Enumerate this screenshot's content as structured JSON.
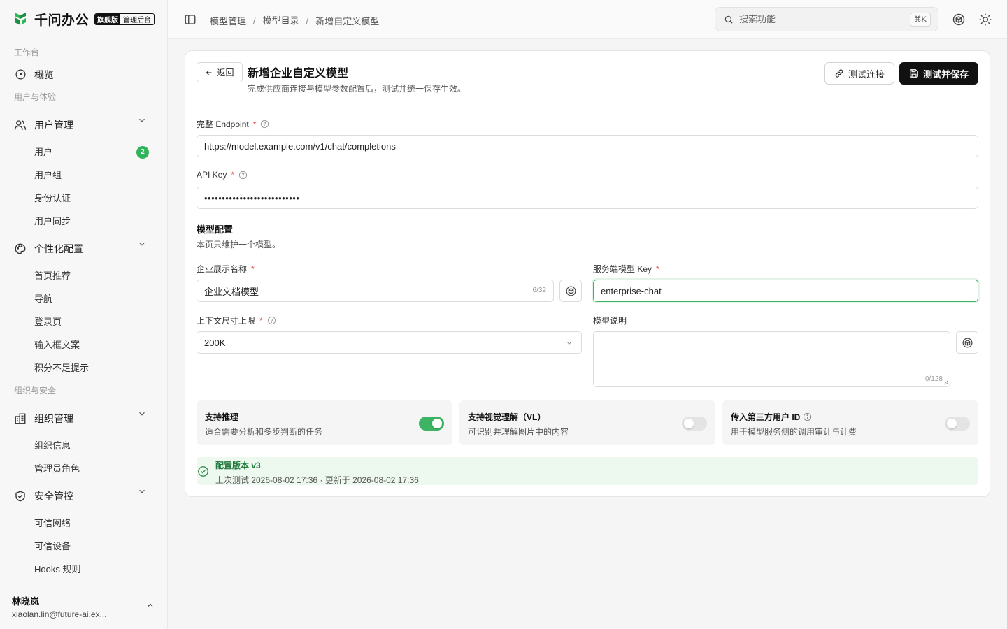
{
  "brand": {
    "name": "千问办公",
    "edition": "旗舰版",
    "admin": "管理后台"
  },
  "nav": {
    "workbench": "工作台",
    "overview": "概览",
    "users_section": "用户与体验",
    "user_mgmt": "用户管理",
    "user_items": [
      {
        "label": "用户",
        "count": "2"
      },
      {
        "label": "用户组"
      },
      {
        "label": "身份认证"
      },
      {
        "label": "用户同步"
      }
    ],
    "personalize": "个性化配置",
    "personalize_items": [
      "首页推荐",
      "导航",
      "登录页",
      "输入框文案",
      "积分不足提示"
    ],
    "org_section": "组织与安全",
    "org_mgmt": "组织管理",
    "org_items": [
      "组织信息",
      "管理员角色"
    ],
    "security": "安全管控",
    "security_items": [
      "可信网络",
      "可信设备",
      "Hooks 规则"
    ]
  },
  "user": {
    "name": "林晓岚",
    "email": "xiaolan.lin@future-ai.ex..."
  },
  "breadcrumb": [
    "模型管理",
    "模型目录",
    "新增自定义模型"
  ],
  "search": {
    "placeholder": "搜索功能",
    "shortcut": "⌘K"
  },
  "page": {
    "back": "返回",
    "title": "新增企业自定义模型",
    "subtitle": "完成供应商连接与模型参数配置后，测试并统一保存生效。",
    "test_button": "测试连接",
    "save_button": "测试并保存"
  },
  "form": {
    "endpoint_label": "完整 Endpoint",
    "endpoint_value": "https://model.example.com/v1/chat/completions",
    "apikey_label": "API Key",
    "apikey_value": "•••••••••••••••••••••••••••",
    "model_config_title": "模型配置",
    "model_config_sub": "本页只维护一个模型。",
    "display_name_label": "企业展示名称",
    "display_name_value": "企业文档模型",
    "display_name_count": "6/32",
    "server_key_label": "服务端模型 Key",
    "server_key_value": "enterprise-chat",
    "context_label": "上下文尺寸上限",
    "context_value": "200K",
    "desc_label": "模型说明",
    "desc_value": "",
    "desc_count": "0/128"
  },
  "features": [
    {
      "title": "支持推理",
      "desc": "适合需要分析和多步判断的任务",
      "on": true
    },
    {
      "title": "支持视觉理解（VL）",
      "desc": "可识别并理解图片中的内容",
      "on": false
    },
    {
      "title": "传入第三方用户 ID",
      "desc": "用于模型服务侧的调用审计与计费",
      "on": false
    }
  ],
  "status": {
    "title": "配置版本 v3",
    "detail": "上次测试 2026-08-02 17:36 · 更新于 2026-08-02 17:36"
  },
  "colors": {
    "accent": "#3cb464",
    "primary": "#111111",
    "required": "#e2483d"
  }
}
